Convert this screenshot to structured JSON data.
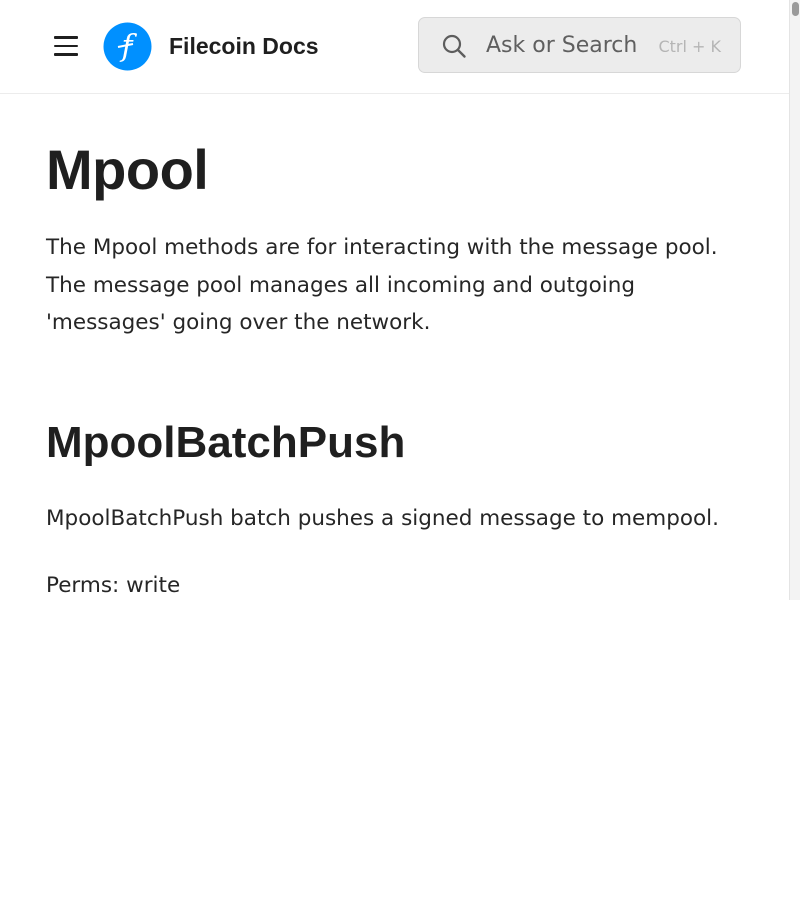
{
  "header": {
    "brand": "Filecoin Docs",
    "logo_letter": "f",
    "search": {
      "placeholder": "Ask or Search",
      "shortcut": "Ctrl + K"
    }
  },
  "main": {
    "title": "Mpool",
    "intro": "The Mpool methods are for interacting with the message pool. The message pool manages all incoming and outgoing 'messages' going over the network.",
    "sections": [
      {
        "heading": "MpoolBatchPush",
        "description": "MpoolBatchPush batch pushes a signed message to mempool.",
        "perms": "Perms: write"
      }
    ]
  },
  "colors": {
    "brand_blue": "#0090ff",
    "text": "#1f1f1f",
    "search_bg": "#ececec",
    "divider": "#ececec"
  },
  "icons": {
    "menu": "hamburger-menu-icon",
    "logo": "filecoin-logo",
    "search": "search-icon"
  }
}
